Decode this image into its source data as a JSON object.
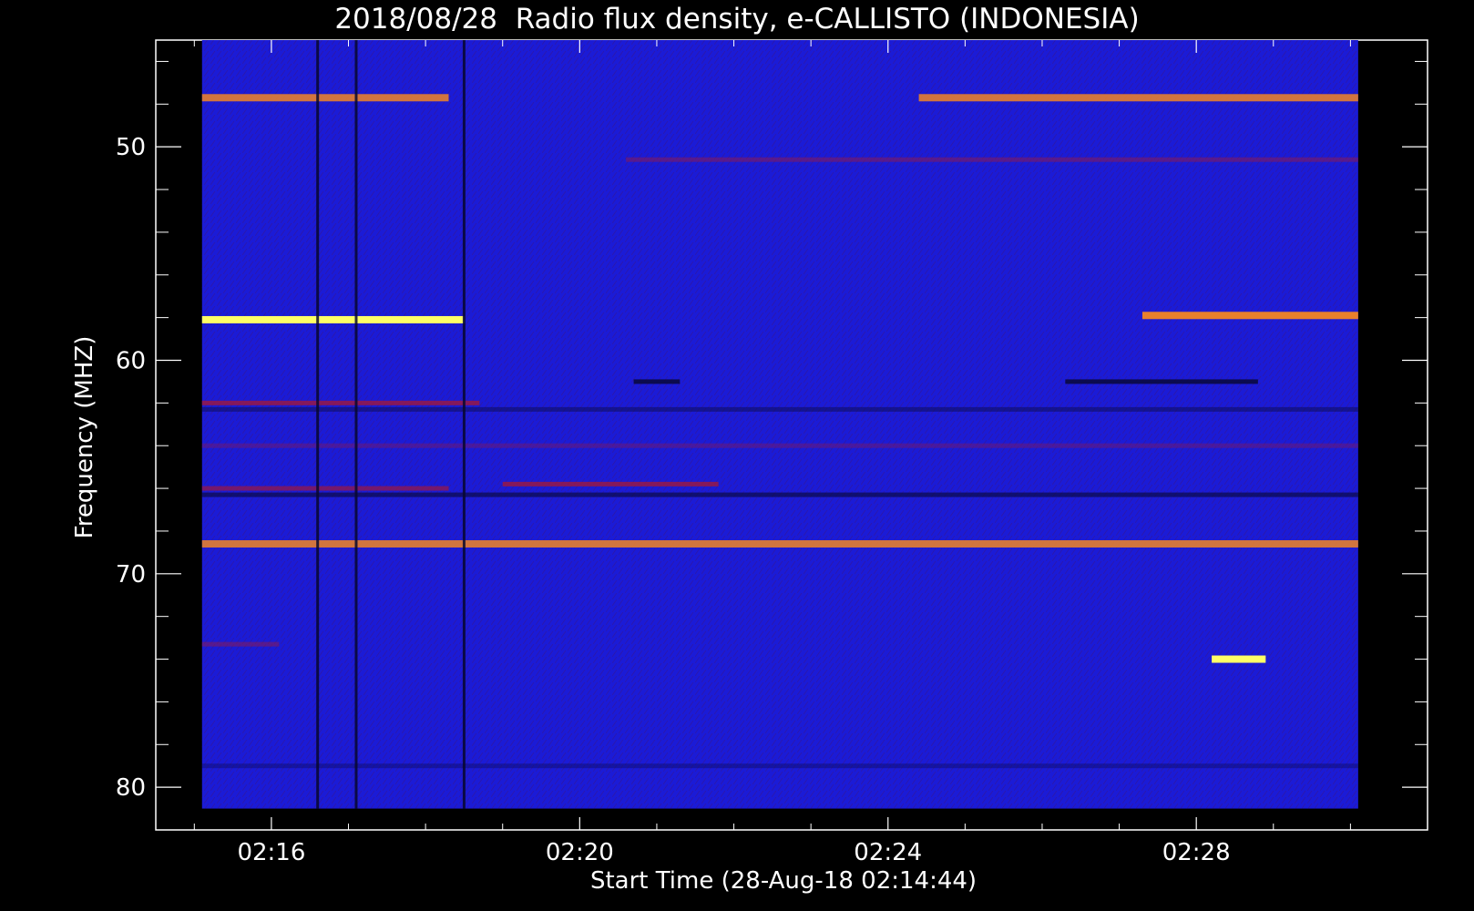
{
  "chart_data": {
    "type": "heatmap",
    "title": "2018/08/28  Radio flux density, e-CALLISTO (INDONESIA)",
    "xlabel": "Start Time (28-Aug-18 02:14:44)",
    "ylabel": "Frequency (MHZ)",
    "x_ticks": [
      "02:16",
      "02:20",
      "02:24",
      "02:28"
    ],
    "x_tick_minutes": [
      16,
      20,
      24,
      28
    ],
    "x_range_minutes": [
      14.5,
      31.0
    ],
    "data_x_range_minutes": [
      15.1,
      30.1
    ],
    "y_ticks": [
      50,
      60,
      70,
      80
    ],
    "y_range": [
      45.0,
      82.0
    ],
    "data_y_range": [
      45.0,
      81.0
    ],
    "y_inverted": true,
    "colors": {
      "background": "#1b1bd6",
      "dark": "#08082e",
      "red": "#b0182a",
      "orange": "#ff8c1a",
      "yellow": "#ffff66"
    },
    "bands": [
      {
        "freq": 47.7,
        "t_start": 15.1,
        "t_end": 18.3,
        "color": "orange",
        "intensity": 0.8
      },
      {
        "freq": 47.7,
        "t_start": 24.4,
        "t_end": 30.1,
        "color": "orange",
        "intensity": 0.8
      },
      {
        "freq": 50.6,
        "t_start": 20.6,
        "t_end": 30.1,
        "color": "red",
        "intensity": 0.4
      },
      {
        "freq": 58.1,
        "t_start": 15.1,
        "t_end": 18.5,
        "color": "yellow",
        "intensity": 1.0
      },
      {
        "freq": 57.9,
        "t_start": 27.3,
        "t_end": 30.1,
        "color": "orange",
        "intensity": 0.9
      },
      {
        "freq": 61.0,
        "t_start": 20.7,
        "t_end": 21.3,
        "color": "dark",
        "intensity": 0.8
      },
      {
        "freq": 61.0,
        "t_start": 26.3,
        "t_end": 28.8,
        "color": "dark",
        "intensity": 0.8
      },
      {
        "freq": 62.0,
        "t_start": 15.1,
        "t_end": 18.7,
        "color": "red",
        "intensity": 0.7
      },
      {
        "freq": 62.3,
        "t_start": 15.1,
        "t_end": 30.1,
        "color": "dark",
        "intensity": 0.4
      },
      {
        "freq": 64.0,
        "t_start": 15.1,
        "t_end": 30.1,
        "color": "red",
        "intensity": 0.3
      },
      {
        "freq": 66.0,
        "t_start": 15.1,
        "t_end": 18.3,
        "color": "red",
        "intensity": 0.6
      },
      {
        "freq": 66.3,
        "t_start": 15.1,
        "t_end": 30.1,
        "color": "dark",
        "intensity": 0.6
      },
      {
        "freq": 65.8,
        "t_start": 19.0,
        "t_end": 21.8,
        "color": "red",
        "intensity": 0.7
      },
      {
        "freq": 68.6,
        "t_start": 15.1,
        "t_end": 30.1,
        "color": "orange",
        "intensity": 0.8
      },
      {
        "freq": 73.3,
        "t_start": 15.1,
        "t_end": 16.1,
        "color": "red",
        "intensity": 0.4
      },
      {
        "freq": 74.0,
        "t_start": 28.2,
        "t_end": 28.9,
        "color": "yellow",
        "intensity": 1.0
      },
      {
        "freq": 79.0,
        "t_start": 15.1,
        "t_end": 30.1,
        "color": "dark",
        "intensity": 0.3
      }
    ],
    "vertical_lines": [
      {
        "time": 16.6,
        "color": "dark"
      },
      {
        "time": 17.1,
        "color": "dark"
      },
      {
        "time": 18.5,
        "color": "dark"
      }
    ]
  }
}
